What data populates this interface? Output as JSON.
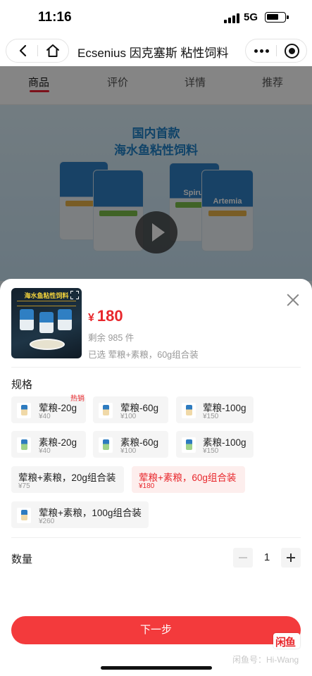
{
  "status_bar": {
    "time": "11:16",
    "network": "5G"
  },
  "nav": {
    "title": "Ecsenius 因克塞斯 粘性饲料"
  },
  "background_page": {
    "tabs": [
      "商品",
      "评价",
      "详情",
      "推荐"
    ],
    "banner_line1": "国内首款",
    "banner_line2": "海水鱼粘性饲料",
    "pack_names": [
      "Spirul",
      "Artemia"
    ]
  },
  "sheet": {
    "thumbnail_title": "海水鱼粘性饲料",
    "price_currency": "¥",
    "price": "180",
    "stock": "剩余 985 件",
    "selected_text": "已选 荤粮+素粮，60g组合装",
    "spec_label": "规格",
    "hot_tag": "热销",
    "options": [
      {
        "name": "荤粮-20g",
        "price": "¥40",
        "selected": false
      },
      {
        "name": "荤粮-60g",
        "price": "¥100",
        "selected": false
      },
      {
        "name": "荤粮-100g",
        "price": "¥150",
        "selected": false
      },
      {
        "name": "素粮-20g",
        "price": "¥40",
        "selected": false
      },
      {
        "name": "素粮-60g",
        "price": "¥100",
        "selected": false
      },
      {
        "name": "素粮-100g",
        "price": "¥150",
        "selected": false
      },
      {
        "name": "荤粮+素粮，20g组合装",
        "price": "¥75",
        "selected": false
      },
      {
        "name": "荤粮+素粮，60g组合装",
        "price": "¥180",
        "selected": true
      },
      {
        "name": "荤粮+素粮，100g组合装",
        "price": "¥260",
        "selected": false
      }
    ],
    "quantity_label": "数量",
    "quantity": "1",
    "next_button": "下一步",
    "watermark_logo": "闲鱼",
    "watermark_text": "闲鱼号：Hi-Wang"
  },
  "colors": {
    "accent": "#e8272c",
    "button": "#f33a3c"
  },
  "icons": [
    "back-icon",
    "home-icon",
    "more-icon",
    "target-icon",
    "play-icon",
    "expand-icon",
    "close-icon",
    "minus-icon",
    "plus-icon",
    "signal-icon",
    "battery-icon"
  ]
}
